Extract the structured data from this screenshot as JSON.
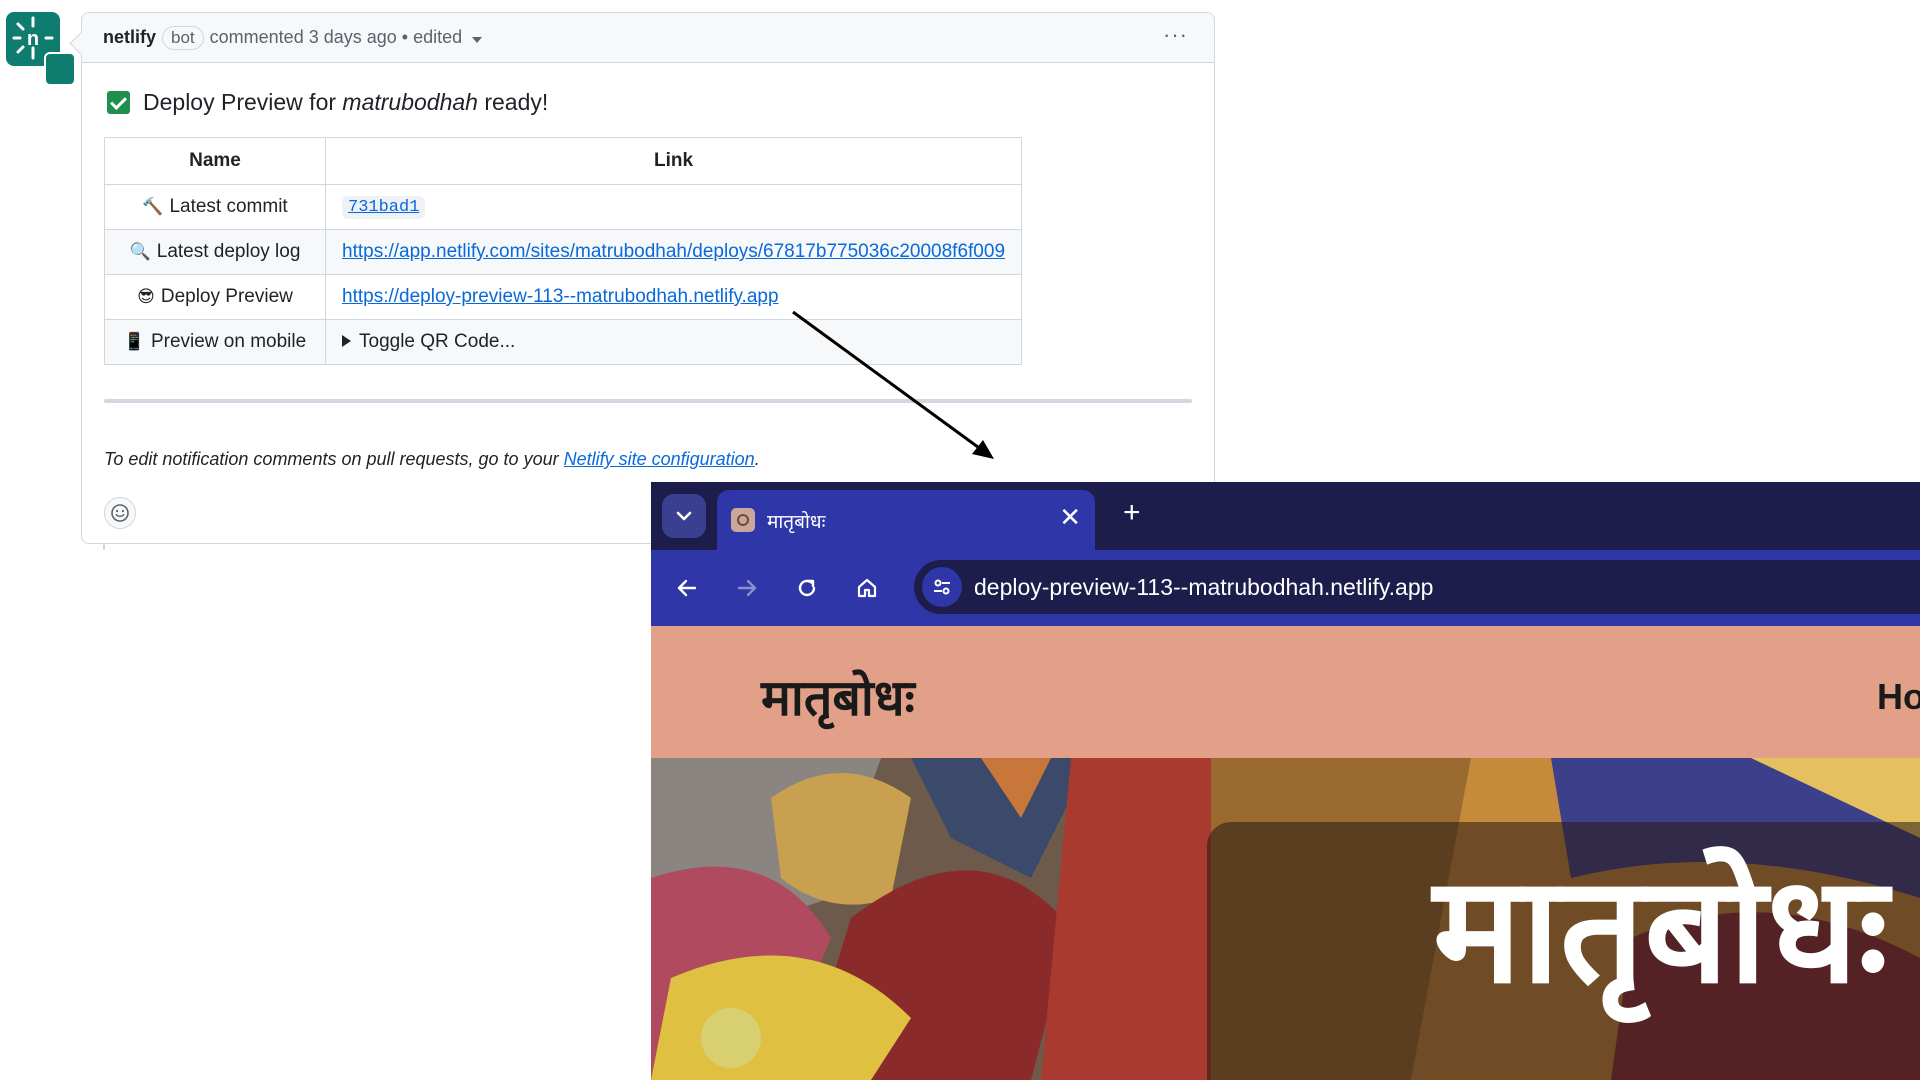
{
  "comment": {
    "author": "netlify",
    "badge": "bot",
    "meta": "commented 3 days ago • edited",
    "title_prefix": "Deploy Preview for ",
    "title_site": "matrubodhah",
    "title_suffix": " ready!",
    "table": {
      "headers": [
        "Name",
        "Link"
      ],
      "rows": [
        {
          "emoji": "🔨",
          "name": "Latest commit",
          "value": "731bad1"
        },
        {
          "emoji": "🔍",
          "name": "Latest deploy log",
          "value": "https://app.netlify.com/sites/matrubodhah/deploys/67817b775036c20008f6f009"
        },
        {
          "emoji": "😎",
          "name": "Deploy Preview",
          "value": "https://deploy-preview-113--matrubodhah.netlify.app"
        },
        {
          "emoji": "📱",
          "name": "Preview on mobile",
          "value": "Toggle QR Code..."
        }
      ]
    },
    "note_prefix": "To edit notification comments on pull requests, go to your ",
    "note_link": "Netlify site configuration",
    "note_suffix": "."
  },
  "browser": {
    "tab_title": "मातृबोधः",
    "url": "deploy-preview-113--matrubodhah.netlify.app",
    "site_logo": "मातृबोधः",
    "nav_partial": "Ho",
    "hero_title": "मातृबोधः"
  },
  "colors": {
    "link": "#0969da",
    "check": "#1f8f4e",
    "browser_chrome": "#2f37a8",
    "browser_dark": "#1c1d4a",
    "site_header": "#e3a088"
  }
}
